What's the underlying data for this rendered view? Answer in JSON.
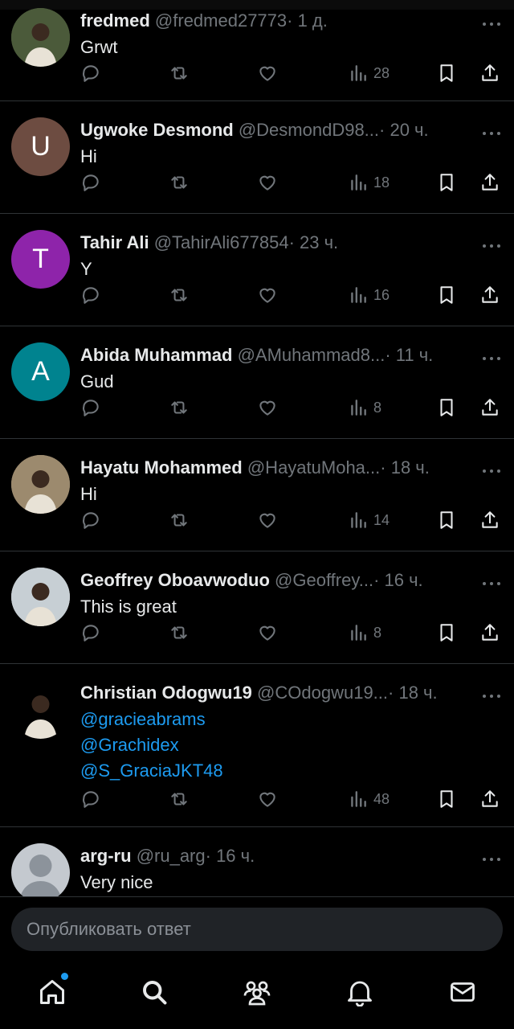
{
  "tweets": [
    {
      "name": "fredmed",
      "handle": "@fredmed27773",
      "time": "· 1 д.",
      "text": "Grwt",
      "views": "28",
      "avatar": {
        "type": "photo",
        "color": "#4b5a3a"
      }
    },
    {
      "name": "Ugwoke Desmond",
      "handle": "@DesmondD98...",
      "time": "· 20 ч.",
      "text": "Hi",
      "views": "18",
      "avatar": {
        "type": "letter",
        "letter": "U",
        "color": "#6d4c41"
      }
    },
    {
      "name": "Tahir Ali",
      "handle": "@TahirAli677854",
      "time": "· 23 ч.",
      "text": "Y",
      "views": "16",
      "avatar": {
        "type": "letter",
        "letter": "T",
        "color": "#8e24aa"
      }
    },
    {
      "name": "Abida Muhammad",
      "handle": "@AMuhammad8...",
      "time": "· 11 ч.",
      "text": "Gud",
      "views": "8",
      "avatar": {
        "type": "letter",
        "letter": "A",
        "color": "#00838f"
      }
    },
    {
      "name": "Hayatu Mohammed",
      "handle": "@HayatuMoha...",
      "time": "· 18 ч.",
      "text": "Hi",
      "views": "14",
      "avatar": {
        "type": "photo",
        "color": "#9c8a6e"
      }
    },
    {
      "name": "Geoffrey Oboavwoduo",
      "handle": "@Geoffrey...",
      "time": "· 16 ч.",
      "text": "This is great",
      "views": "8",
      "avatar": {
        "type": "photo",
        "color": "#c7cfd4"
      }
    },
    {
      "name": "Christian Odogwu19",
      "handle": "@COdogwu19...",
      "time": "· 18 ч.",
      "mentions": [
        "@gracieabrams",
        "@Grachidex",
        "@S_GraciaJKT48"
      ],
      "views": "48",
      "avatar": {
        "type": "photo",
        "color": "#000000"
      }
    },
    {
      "name": "arg-ru",
      "handle": "@ru_arg",
      "time": "· 16 ч.",
      "text": "Very nice",
      "avatar": {
        "type": "default",
        "color": "#c4c9cf"
      }
    }
  ],
  "reply": {
    "placeholder": "Опубликовать ответ"
  },
  "nav": {
    "items": [
      "home-icon",
      "search-icon",
      "communities-icon",
      "notifications-icon",
      "messages-icon"
    ],
    "home_has_dot": true
  },
  "colors": {
    "accent": "#1d9bf0",
    "muted": "#71767b",
    "background": "#000000",
    "divider": "#2f3336"
  }
}
